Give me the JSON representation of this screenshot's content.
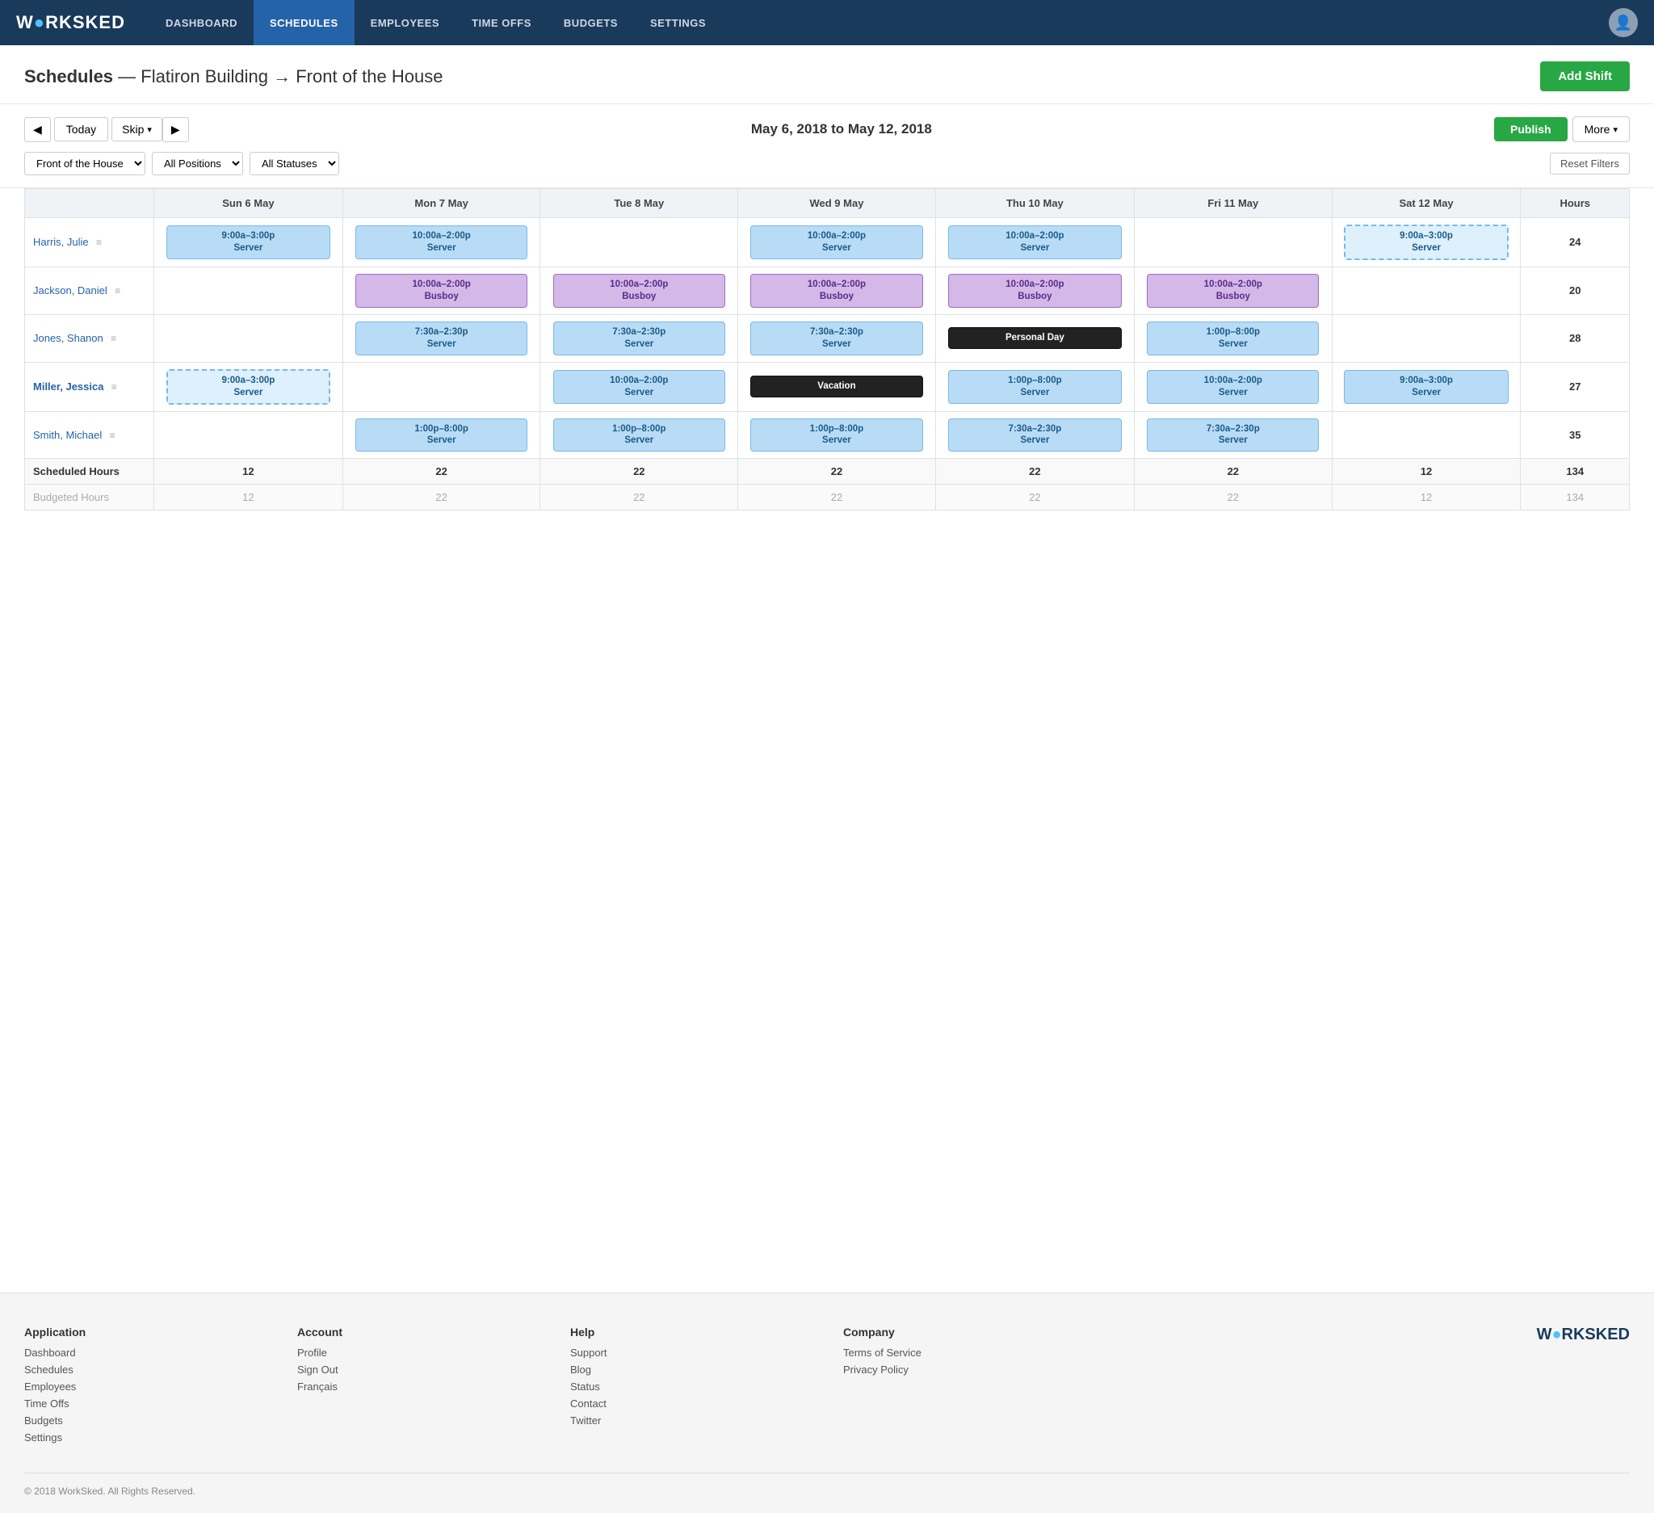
{
  "nav": {
    "logo": "W●RKSKED",
    "items": [
      {
        "label": "DASHBOARD",
        "active": false
      },
      {
        "label": "SCHEDULES",
        "active": true
      },
      {
        "label": "EMPLOYEES",
        "active": false
      },
      {
        "label": "TIME OFFS",
        "active": false
      },
      {
        "label": "BUDGETS",
        "active": false
      },
      {
        "label": "SETTINGS",
        "active": false
      }
    ]
  },
  "header": {
    "title_bold": "Schedules",
    "title_rest": " — Flatiron Building → Front of the House",
    "add_shift": "Add Shift"
  },
  "controls": {
    "today": "Today",
    "skip": "Skip",
    "date_range": "May 6, 2018 to May 12, 2018",
    "publish": "Publish",
    "more": "More",
    "filter_location": "Front of the House",
    "filter_positions": "All Positions",
    "filter_statuses": "All Statuses",
    "reset_filters": "Reset Filters"
  },
  "table": {
    "columns": [
      "",
      "Sun 6 May",
      "Mon 7 May",
      "Tue 8 May",
      "Wed 9 May",
      "Thu 10 May",
      "Fri 11 May",
      "Sat 12 May",
      "Hours"
    ],
    "rows": [
      {
        "name": "Harris, Julie",
        "cells": [
          {
            "type": "server",
            "label": "9:00a–3:00p\nServer"
          },
          {
            "type": "server",
            "label": "10:00a–2:00p\nServer"
          },
          {
            "type": "empty"
          },
          {
            "type": "server",
            "label": "10:00a–2:00p\nServer"
          },
          {
            "type": "server",
            "label": "10:00a–2:00p\nServer"
          },
          {
            "type": "empty"
          },
          {
            "type": "server-dashed",
            "label": "9:00a–3:00p\nServer"
          }
        ],
        "hours": "24"
      },
      {
        "name": "Jackson, Daniel",
        "cells": [
          {
            "type": "empty"
          },
          {
            "type": "busboy",
            "label": "10:00a–2:00p\nBusboy"
          },
          {
            "type": "busboy",
            "label": "10:00a–2:00p\nBusboy"
          },
          {
            "type": "busboy",
            "label": "10:00a–2:00p\nBusboy"
          },
          {
            "type": "busboy",
            "label": "10:00a–2:00p\nBusboy"
          },
          {
            "type": "busboy",
            "label": "10:00a–2:00p\nBusboy"
          },
          {
            "type": "empty"
          }
        ],
        "hours": "20"
      },
      {
        "name": "Jones, Shanon",
        "cells": [
          {
            "type": "empty"
          },
          {
            "type": "server",
            "label": "7:30a–2:30p\nServer"
          },
          {
            "type": "server",
            "label": "7:30a–2:30p\nServer"
          },
          {
            "type": "server",
            "label": "7:30a–2:30p\nServer"
          },
          {
            "type": "personal",
            "label": "Personal Day"
          },
          {
            "type": "server",
            "label": "1:00p–8:00p\nServer"
          },
          {
            "type": "empty"
          }
        ],
        "hours": "28"
      },
      {
        "name": "Miller, Jessica",
        "bold": true,
        "cells": [
          {
            "type": "server-dashed",
            "label": "9:00a–3:00p\nServer"
          },
          {
            "type": "empty"
          },
          {
            "type": "server",
            "label": "10:00a–2:00p\nServer"
          },
          {
            "type": "vacation",
            "label": "Vacation"
          },
          {
            "type": "server",
            "label": "1:00p–8:00p\nServer"
          },
          {
            "type": "server",
            "label": "10:00a–2:00p\nServer"
          },
          {
            "type": "server",
            "label": "9:00a–3:00p\nServer"
          }
        ],
        "hours": "27"
      },
      {
        "name": "Smith, Michael",
        "cells": [
          {
            "type": "empty"
          },
          {
            "type": "server",
            "label": "1:00p–8:00p\nServer"
          },
          {
            "type": "server",
            "label": "1:00p–8:00p\nServer"
          },
          {
            "type": "server",
            "label": "1:00p–8:00p\nServer"
          },
          {
            "type": "server",
            "label": "7:30a–2:30p\nServer"
          },
          {
            "type": "server",
            "label": "7:30a–2:30p\nServer"
          },
          {
            "type": "empty"
          }
        ],
        "hours": "35"
      }
    ],
    "scheduled": {
      "label": "Scheduled Hours",
      "values": [
        "12",
        "22",
        "22",
        "22",
        "22",
        "22",
        "12",
        "134"
      ]
    },
    "budgeted": {
      "label": "Budgeted Hours",
      "values": [
        "12",
        "22",
        "22",
        "22",
        "22",
        "22",
        "12",
        "134"
      ]
    }
  },
  "footer": {
    "cols": [
      {
        "heading": "Application",
        "links": [
          "Dashboard",
          "Schedules",
          "Employees",
          "Time Offs",
          "Budgets",
          "Settings"
        ]
      },
      {
        "heading": "Account",
        "links": [
          "Profile",
          "Sign Out",
          "Français"
        ]
      },
      {
        "heading": "Help",
        "links": [
          "Support",
          "Blog",
          "Status",
          "Contact",
          "Twitter"
        ]
      },
      {
        "heading": "Company",
        "links": [
          "Terms of Service",
          "Privacy Policy"
        ]
      }
    ],
    "logo": "W●RKSKED",
    "copyright": "© 2018 WorkSked. All Rights Reserved."
  }
}
